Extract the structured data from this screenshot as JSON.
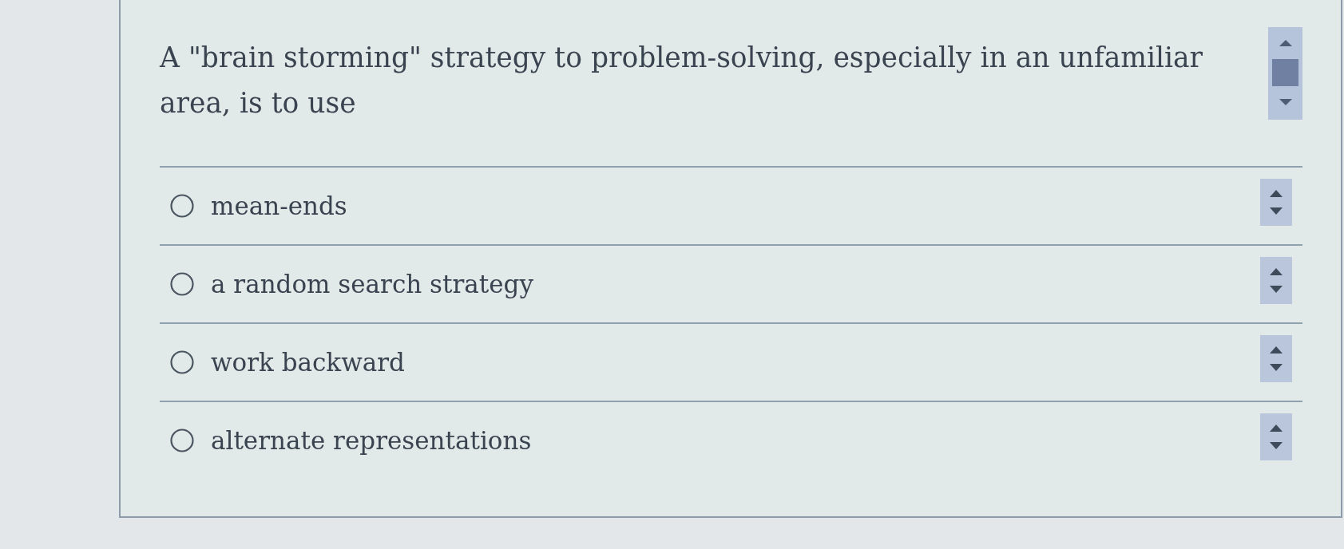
{
  "question": {
    "text": "A \"brain storming\" strategy to problem-solving, especially in an unfamiliar area, is to use"
  },
  "options": [
    {
      "label": "mean-ends",
      "selected": false
    },
    {
      "label": "a random search strategy",
      "selected": false
    },
    {
      "label": "work backward",
      "selected": false
    },
    {
      "label": "alternate representations",
      "selected": false
    }
  ]
}
